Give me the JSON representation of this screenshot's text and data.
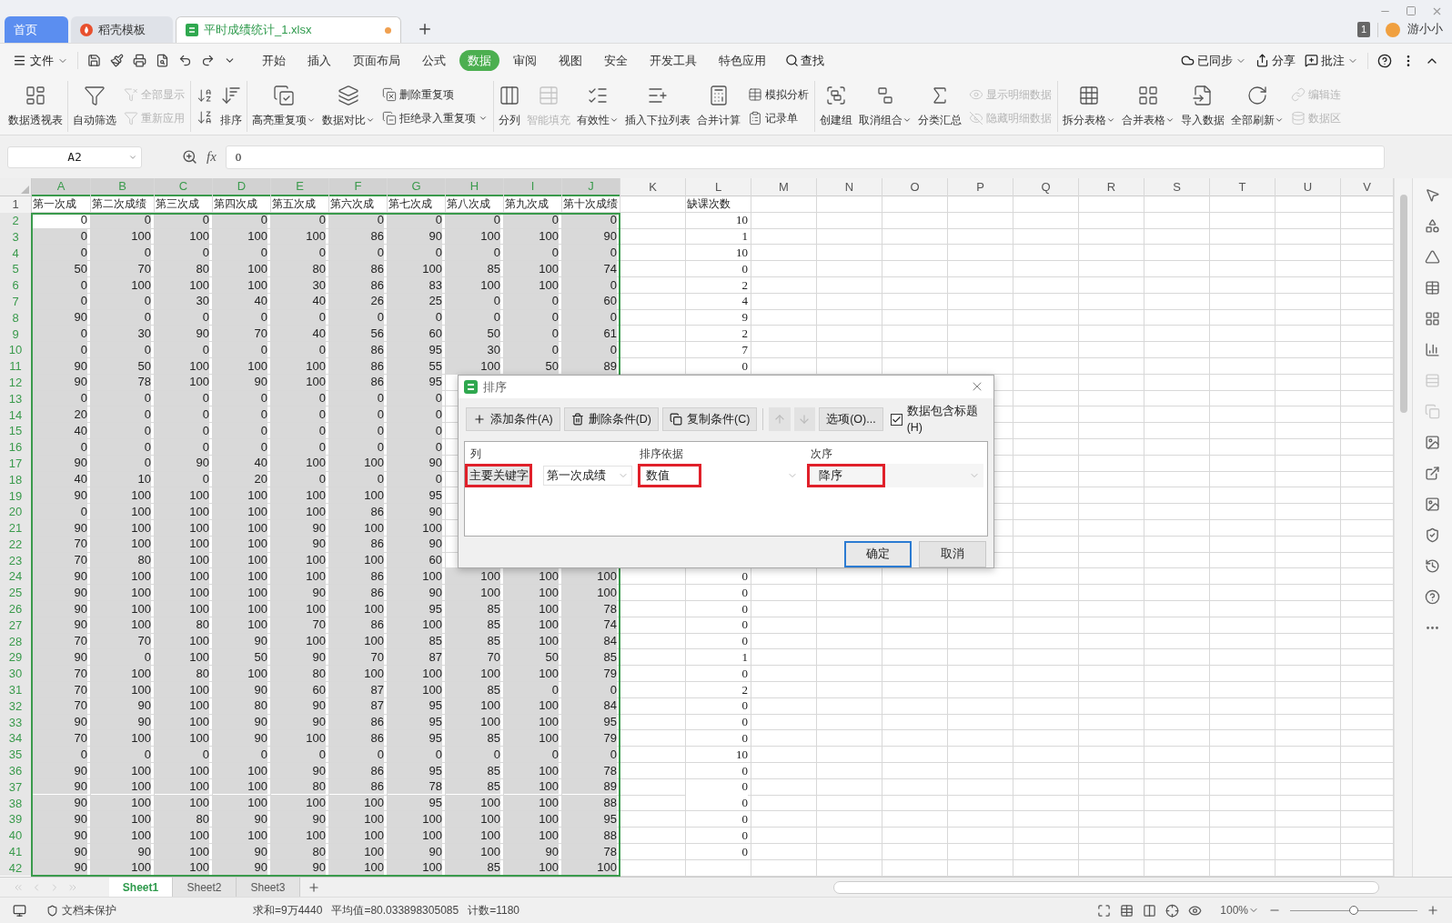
{
  "tabs": [
    {
      "label": "首页",
      "kind": "home",
      "selected": false,
      "unsaved": false
    },
    {
      "label": "稻壳模板",
      "kind": "docer",
      "selected": false,
      "unsaved": false
    },
    {
      "label": "平时成绩统计_1.xlsx",
      "kind": "sheet",
      "selected": true,
      "unsaved": true
    }
  ],
  "account": {
    "badge": "1",
    "user": "游小小"
  },
  "file_menu": "文件",
  "menu_tabs": [
    {
      "label": "开始",
      "selected": false
    },
    {
      "label": "插入",
      "selected": false
    },
    {
      "label": "页面布局",
      "selected": false
    },
    {
      "label": "公式",
      "selected": false
    },
    {
      "label": "数据",
      "selected": true
    },
    {
      "label": "审阅",
      "selected": false
    },
    {
      "label": "视图",
      "selected": false
    },
    {
      "label": "安全",
      "selected": false
    },
    {
      "label": "开发工具",
      "selected": false
    },
    {
      "label": "特色应用",
      "selected": false
    }
  ],
  "search": "查找",
  "menu_right": [
    {
      "label": "已同步",
      "dropdown": true
    },
    {
      "label": "分享",
      "dropdown": false
    },
    {
      "label": "批注",
      "dropdown": true
    }
  ],
  "ribbon": [
    {
      "items": [
        {
          "kind": "big",
          "label": "数据透视表",
          "disabled": false,
          "dropdown": false
        }
      ]
    },
    {
      "items": [
        {
          "kind": "big",
          "label": "自动筛选",
          "disabled": false,
          "dropdown": false
        },
        {
          "kind": "stack",
          "items": [
            {
              "label": "全部显示",
              "disabled": true,
              "dropdown": false
            },
            {
              "label": "重新应用",
              "disabled": true,
              "dropdown": false
            }
          ]
        }
      ]
    },
    {
      "items": [
        {
          "kind": "sort_pair"
        },
        {
          "kind": "big",
          "label": "排序",
          "disabled": false,
          "dropdown": false
        }
      ]
    },
    {
      "items": [
        {
          "kind": "big",
          "label": "高亮重复项",
          "disabled": false,
          "dropdown": true
        },
        {
          "kind": "big",
          "label": "数据对比",
          "disabled": false,
          "dropdown": true
        },
        {
          "kind": "stack",
          "items": [
            {
              "label": "删除重复项",
              "disabled": false,
              "dropdown": false
            },
            {
              "label": "拒绝录入重复项",
              "disabled": false,
              "dropdown": true
            }
          ]
        }
      ]
    },
    {
      "items": [
        {
          "kind": "big",
          "label": "分列",
          "disabled": false,
          "dropdown": false
        },
        {
          "kind": "big",
          "label": "智能填充",
          "disabled": true,
          "dropdown": false
        },
        {
          "kind": "big",
          "label": "有效性",
          "disabled": false,
          "dropdown": true
        },
        {
          "kind": "big",
          "label": "插入下拉列表",
          "disabled": false,
          "dropdown": false
        },
        {
          "kind": "big",
          "label": "合并计算",
          "disabled": false,
          "dropdown": false
        },
        {
          "kind": "stack",
          "items": [
            {
              "label": "模拟分析",
              "disabled": false,
              "dropdown": false
            },
            {
              "label": "记录单",
              "disabled": false,
              "dropdown": false
            }
          ]
        }
      ]
    },
    {
      "items": [
        {
          "kind": "big",
          "label": "创建组",
          "disabled": false,
          "dropdown": false
        },
        {
          "kind": "big",
          "label": "取消组合",
          "disabled": false,
          "dropdown": true
        },
        {
          "kind": "big",
          "label": "分类汇总",
          "disabled": false,
          "dropdown": false
        },
        {
          "kind": "stack",
          "items": [
            {
              "label": "显示明细数据",
              "disabled": true,
              "dropdown": false
            },
            {
              "label": "隐藏明细数据",
              "disabled": true,
              "dropdown": false
            }
          ]
        }
      ]
    },
    {
      "items": [
        {
          "kind": "big",
          "label": "拆分表格",
          "disabled": false,
          "dropdown": true
        },
        {
          "kind": "big",
          "label": "合并表格",
          "disabled": false,
          "dropdown": true
        },
        {
          "kind": "big",
          "label": "导入数据",
          "disabled": false,
          "dropdown": false
        },
        {
          "kind": "big",
          "label": "全部刷新",
          "disabled": false,
          "dropdown": true
        },
        {
          "kind": "stack",
          "items": [
            {
              "label": "编辑连",
              "disabled": true,
              "dropdown": false
            },
            {
              "label": "数据区",
              "disabled": true,
              "dropdown": false
            }
          ]
        }
      ]
    }
  ],
  "formula_bar": {
    "name_box": "A2",
    "fx": "fx",
    "value": "0"
  },
  "columns": [
    {
      "label": "A",
      "selected": true
    },
    {
      "label": "B",
      "selected": true
    },
    {
      "label": "C",
      "selected": true
    },
    {
      "label": "D",
      "selected": true
    },
    {
      "label": "E",
      "selected": true
    },
    {
      "label": "F",
      "selected": true
    },
    {
      "label": "G",
      "selected": true
    },
    {
      "label": "H",
      "selected": true
    },
    {
      "label": "I",
      "selected": true
    },
    {
      "label": "J",
      "selected": true
    },
    {
      "label": "K",
      "selected": false
    },
    {
      "label": "L",
      "selected": false
    },
    {
      "label": "M",
      "selected": false
    },
    {
      "label": "N",
      "selected": false
    },
    {
      "label": "O",
      "selected": false
    },
    {
      "label": "P",
      "selected": false
    },
    {
      "label": "Q",
      "selected": false
    },
    {
      "label": "R",
      "selected": false
    },
    {
      "label": "S",
      "selected": false
    },
    {
      "label": "T",
      "selected": false
    },
    {
      "label": "U",
      "selected": false
    },
    {
      "label": "V",
      "selected": false
    }
  ],
  "rows": [
    {
      "label": "1",
      "kind": "header",
      "selected": false,
      "cells": [
        "第一次成",
        "第二次成绩",
        "第三次成",
        "第四次成",
        "第五次成",
        "第六次成",
        "第七次成",
        "第八次成",
        "第九次成",
        "第十次成绩",
        null,
        "缺课次数"
      ]
    },
    {
      "label": "2",
      "kind": "data",
      "selected": true,
      "cells": [
        "0",
        "0",
        "0",
        "0",
        "0",
        "0",
        "0",
        "0",
        "0",
        "0",
        null,
        "10"
      ]
    },
    {
      "label": "3",
      "kind": "data",
      "selected": true,
      "cells": [
        "0",
        "100",
        "100",
        "100",
        "100",
        "86",
        "90",
        "100",
        "100",
        "90",
        null,
        "1"
      ]
    },
    {
      "label": "4",
      "kind": "data",
      "selected": true,
      "cells": [
        "0",
        "0",
        "0",
        "0",
        "0",
        "0",
        "0",
        "0",
        "0",
        "0",
        null,
        "10"
      ]
    },
    {
      "label": "5",
      "kind": "data",
      "selected": true,
      "cells": [
        "50",
        "70",
        "80",
        "100",
        "80",
        "86",
        "100",
        "85",
        "100",
        "74",
        null,
        "0"
      ]
    },
    {
      "label": "6",
      "kind": "data",
      "selected": true,
      "cells": [
        "0",
        "100",
        "100",
        "100",
        "30",
        "86",
        "83",
        "100",
        "100",
        "0",
        null,
        "2"
      ]
    },
    {
      "label": "7",
      "kind": "data",
      "selected": true,
      "cells": [
        "0",
        "0",
        "30",
        "40",
        "40",
        "26",
        "25",
        "0",
        "0",
        "60",
        null,
        "4"
      ]
    },
    {
      "label": "8",
      "kind": "data",
      "selected": true,
      "cells": [
        "90",
        "0",
        "0",
        "0",
        "0",
        "0",
        "0",
        "0",
        "0",
        "0",
        null,
        "9"
      ]
    },
    {
      "label": "9",
      "kind": "data",
      "selected": true,
      "cells": [
        "0",
        "30",
        "90",
        "70",
        "40",
        "56",
        "60",
        "50",
        "0",
        "61",
        null,
        "2"
      ]
    },
    {
      "label": "10",
      "kind": "data",
      "selected": true,
      "cells": [
        "0",
        "0",
        "0",
        "0",
        "0",
        "86",
        "95",
        "30",
        "0",
        "0",
        null,
        "7"
      ]
    },
    {
      "label": "11",
      "kind": "data",
      "selected": true,
      "cells": [
        "90",
        "50",
        "100",
        "100",
        "100",
        "86",
        "55",
        "100",
        "50",
        "89",
        null,
        "0"
      ]
    },
    {
      "label": "12",
      "kind": "data",
      "selected": true,
      "cells": [
        "90",
        "78",
        "100",
        "90",
        "100",
        "86",
        "95"
      ]
    },
    {
      "label": "13",
      "kind": "data",
      "selected": true,
      "cells": [
        "0",
        "0",
        "0",
        "0",
        "0",
        "0",
        "0"
      ]
    },
    {
      "label": "14",
      "kind": "data",
      "selected": true,
      "cells": [
        "20",
        "0",
        "0",
        "0",
        "0",
        "0",
        "0"
      ]
    },
    {
      "label": "15",
      "kind": "data",
      "selected": true,
      "cells": [
        "40",
        "0",
        "0",
        "0",
        "0",
        "0",
        "0"
      ]
    },
    {
      "label": "16",
      "kind": "data",
      "selected": true,
      "cells": [
        "0",
        "0",
        "0",
        "0",
        "0",
        "0",
        "0"
      ]
    },
    {
      "label": "17",
      "kind": "data",
      "selected": true,
      "cells": [
        "90",
        "0",
        "90",
        "40",
        "100",
        "100",
        "90"
      ]
    },
    {
      "label": "18",
      "kind": "data",
      "selected": true,
      "cells": [
        "40",
        "10",
        "0",
        "20",
        "0",
        "0",
        "0"
      ]
    },
    {
      "label": "19",
      "kind": "data",
      "selected": true,
      "cells": [
        "90",
        "100",
        "100",
        "100",
        "100",
        "100",
        "95"
      ]
    },
    {
      "label": "20",
      "kind": "data",
      "selected": true,
      "cells": [
        "0",
        "100",
        "100",
        "100",
        "100",
        "86",
        "90"
      ]
    },
    {
      "label": "21",
      "kind": "data",
      "selected": true,
      "cells": [
        "90",
        "100",
        "100",
        "100",
        "90",
        "100",
        "100"
      ]
    },
    {
      "label": "22",
      "kind": "data",
      "selected": true,
      "cells": [
        "70",
        "100",
        "100",
        "100",
        "90",
        "86",
        "90"
      ]
    },
    {
      "label": "23",
      "kind": "data",
      "selected": true,
      "cells": [
        "70",
        "80",
        "100",
        "100",
        "100",
        "100",
        "60"
      ]
    },
    {
      "label": "24",
      "kind": "data",
      "selected": true,
      "cells": [
        "90",
        "100",
        "100",
        "100",
        "100",
        "86",
        "100",
        "100",
        "100",
        "100",
        null,
        "0"
      ]
    },
    {
      "label": "25",
      "kind": "data",
      "selected": true,
      "cells": [
        "90",
        "100",
        "100",
        "100",
        "90",
        "86",
        "90",
        "100",
        "100",
        "100",
        null,
        "0"
      ]
    },
    {
      "label": "26",
      "kind": "data",
      "selected": true,
      "cells": [
        "90",
        "100",
        "100",
        "100",
        "100",
        "100",
        "95",
        "85",
        "100",
        "78",
        null,
        "0"
      ]
    },
    {
      "label": "27",
      "kind": "data",
      "selected": true,
      "cells": [
        "90",
        "100",
        "80",
        "100",
        "70",
        "86",
        "100",
        "85",
        "100",
        "74",
        null,
        "0"
      ]
    },
    {
      "label": "28",
      "kind": "data",
      "selected": true,
      "cells": [
        "70",
        "70",
        "100",
        "90",
        "100",
        "100",
        "85",
        "85",
        "100",
        "84",
        null,
        "0"
      ]
    },
    {
      "label": "29",
      "kind": "data",
      "selected": true,
      "cells": [
        "90",
        "0",
        "100",
        "50",
        "90",
        "70",
        "87",
        "70",
        "50",
        "85",
        null,
        "1"
      ]
    },
    {
      "label": "30",
      "kind": "data",
      "selected": true,
      "cells": [
        "70",
        "100",
        "80",
        "100",
        "80",
        "100",
        "100",
        "100",
        "100",
        "79",
        null,
        "0"
      ]
    },
    {
      "label": "31",
      "kind": "data",
      "selected": true,
      "cells": [
        "70",
        "100",
        "100",
        "90",
        "60",
        "87",
        "100",
        "85",
        "0",
        "0",
        null,
        "2"
      ]
    },
    {
      "label": "32",
      "kind": "data",
      "selected": true,
      "cells": [
        "70",
        "90",
        "100",
        "80",
        "90",
        "87",
        "95",
        "100",
        "100",
        "84",
        null,
        "0"
      ]
    },
    {
      "label": "33",
      "kind": "data",
      "selected": true,
      "cells": [
        "90",
        "90",
        "100",
        "90",
        "90",
        "86",
        "95",
        "100",
        "100",
        "95",
        null,
        "0"
      ]
    },
    {
      "label": "34",
      "kind": "data",
      "selected": true,
      "cells": [
        "70",
        "100",
        "100",
        "90",
        "100",
        "86",
        "95",
        "85",
        "100",
        "79",
        null,
        "0"
      ]
    },
    {
      "label": "35",
      "kind": "data",
      "selected": true,
      "cells": [
        "0",
        "0",
        "0",
        "0",
        "0",
        "0",
        "0",
        "0",
        "0",
        "0",
        null,
        "10"
      ]
    },
    {
      "label": "36",
      "kind": "data",
      "selected": true,
      "cells": [
        "90",
        "100",
        "100",
        "100",
        "90",
        "86",
        "95",
        "85",
        "100",
        "78",
        null,
        "0"
      ]
    },
    {
      "label": "37",
      "kind": "data",
      "selected": true,
      "cells": [
        "90",
        "100",
        "100",
        "100",
        "80",
        "86",
        "78",
        "85",
        "100",
        "89",
        null,
        "0"
      ]
    },
    {
      "label": "38",
      "kind": "data",
      "selected": true,
      "cells": [
        "90",
        "100",
        "100",
        "100",
        "100",
        "100",
        "95",
        "100",
        "100",
        "88",
        null,
        "0"
      ]
    },
    {
      "label": "39",
      "kind": "data",
      "selected": true,
      "cells": [
        "90",
        "100",
        "80",
        "90",
        "90",
        "100",
        "100",
        "100",
        "100",
        "95",
        null,
        "0"
      ]
    },
    {
      "label": "40",
      "kind": "data",
      "selected": true,
      "cells": [
        "90",
        "100",
        "100",
        "100",
        "100",
        "100",
        "100",
        "100",
        "100",
        "88",
        null,
        "0"
      ]
    },
    {
      "label": "41",
      "kind": "data",
      "selected": true,
      "cells": [
        "90",
        "90",
        "100",
        "90",
        "80",
        "100",
        "90",
        "100",
        "90",
        "78",
        null,
        "0"
      ]
    },
    {
      "label": "42",
      "kind": "data",
      "selected": true,
      "cells": [
        "90",
        "100",
        "100",
        "90",
        "90",
        "100",
        "100",
        "85",
        "100",
        "100"
      ]
    }
  ],
  "sheets": [
    {
      "label": "Sheet1",
      "selected": true
    },
    {
      "label": "Sheet2",
      "selected": false
    },
    {
      "label": "Sheet3",
      "selected": false
    }
  ],
  "dialog": {
    "title": "排序",
    "toolbar": [
      {
        "kind": "add",
        "label": "添加条件(A)",
        "disabled": false
      },
      {
        "kind": "delete",
        "label": "删除条件(D)",
        "disabled": false
      },
      {
        "kind": "copy",
        "label": "复制条件(C)",
        "disabled": false
      },
      {
        "kind": "up",
        "disabled": true
      },
      {
        "kind": "down",
        "disabled": true
      },
      {
        "kind": "text",
        "label": "选项(O)...",
        "disabled": false
      }
    ],
    "has_header": {
      "label": "数据包含标题(H)",
      "checked": true
    },
    "headers": [
      "列",
      "排序依据",
      "次序"
    ],
    "conditions": [
      {
        "key": "主要关键字",
        "column": "第一次成绩",
        "basis": "数值",
        "order": "降序",
        "highlighted": true
      }
    ],
    "buttons": [
      {
        "label": "确定",
        "default": true
      },
      {
        "label": "取消",
        "default": false
      }
    ]
  },
  "status": {
    "protection": "文档未保护",
    "stats": [
      "求和=9万4440",
      "平均值=80.033898305085",
      "计数=1180"
    ],
    "zoom": "100%",
    "level": 0.5
  }
}
